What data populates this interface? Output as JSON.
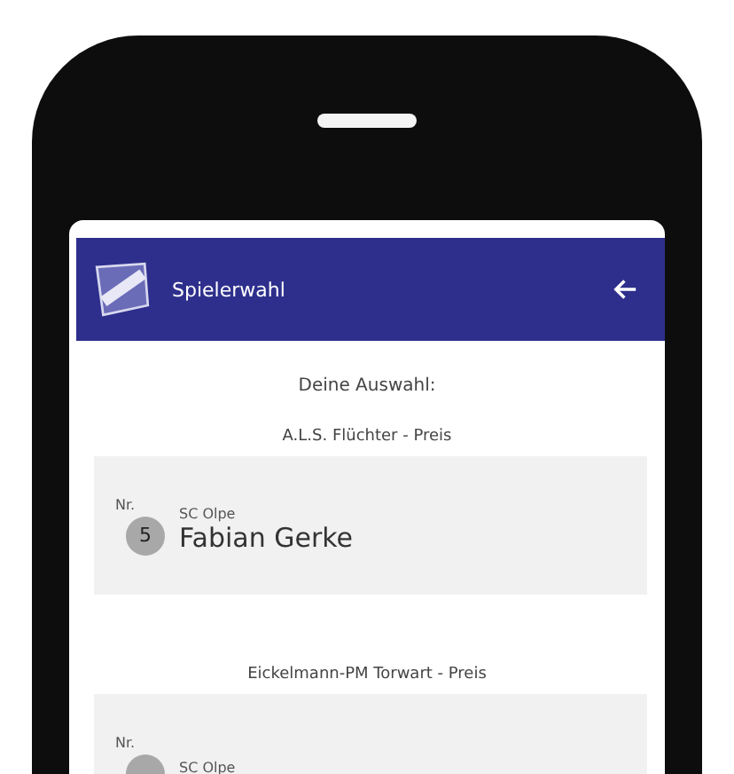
{
  "header": {
    "title": "Spielerwahl"
  },
  "intro": "Deine Auswahl:",
  "sections": [
    {
      "title": "A.L.S. Flüchter - Preis",
      "card": {
        "nr_label": "Nr.",
        "number": "5",
        "club": "SC Olpe",
        "name": "Fabian Gerke"
      }
    },
    {
      "title": "Eickelmann-PM Torwart - Preis",
      "card": {
        "nr_label": "Nr.",
        "club": "SC Olpe"
      }
    }
  ]
}
